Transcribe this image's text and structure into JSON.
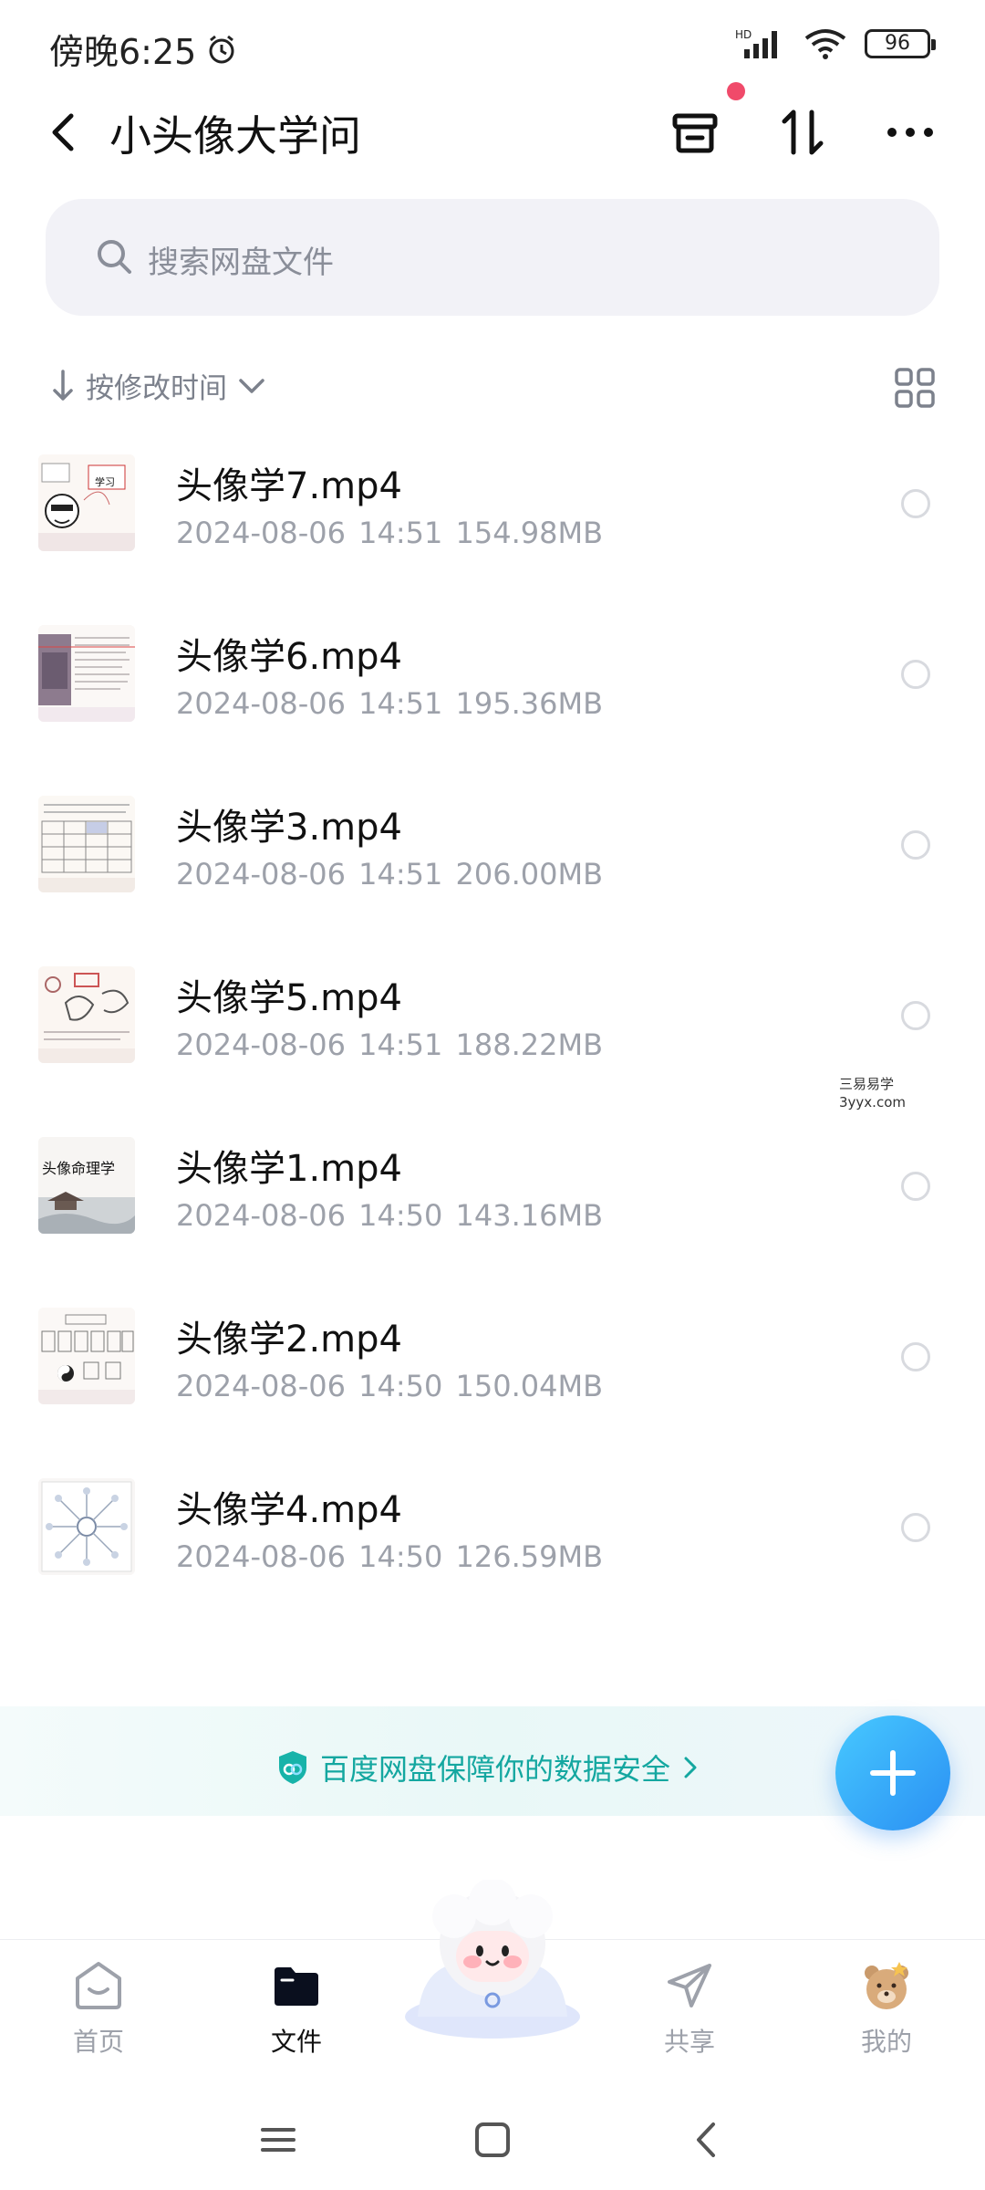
{
  "status_bar": {
    "time": "傍晚6:25",
    "battery": "96",
    "network_label": "HD"
  },
  "header": {
    "title": "小头像大学问"
  },
  "search": {
    "placeholder": "搜索网盘文件"
  },
  "sort": {
    "label": "按修改时间"
  },
  "files": [
    {
      "name": "头像学7.mp4",
      "date": "2024-08-06",
      "time": "14:51",
      "size": "154.98MB"
    },
    {
      "name": "头像学6.mp4",
      "date": "2024-08-06",
      "time": "14:51",
      "size": "195.36MB"
    },
    {
      "name": "头像学3.mp4",
      "date": "2024-08-06",
      "time": "14:51",
      "size": "206.00MB"
    },
    {
      "name": "头像学5.mp4",
      "date": "2024-08-06",
      "time": "14:51",
      "size": "188.22MB"
    },
    {
      "name": "头像学1.mp4",
      "date": "2024-08-06",
      "time": "14:50",
      "size": "143.16MB"
    },
    {
      "name": "头像学2.mp4",
      "date": "2024-08-06",
      "time": "14:50",
      "size": "150.04MB"
    },
    {
      "name": "头像学4.mp4",
      "date": "2024-08-06",
      "time": "14:50",
      "size": "126.59MB"
    }
  ],
  "thumb_text": {
    "title_card": "头像命理学",
    "thumb7_label": "学习"
  },
  "watermark": {
    "line1": "三易易学",
    "line2": "3yyx.com"
  },
  "banner": {
    "text": "百度网盘保障你的数据安全"
  },
  "tabs": [
    {
      "label": "首页"
    },
    {
      "label": "文件"
    },
    {
      "label": "共享"
    },
    {
      "label": "我的"
    }
  ],
  "colors": {
    "accent_teal": "#14a7a0",
    "fab_blue": "#2a8ff3",
    "notification_red": "#f04a6a"
  }
}
